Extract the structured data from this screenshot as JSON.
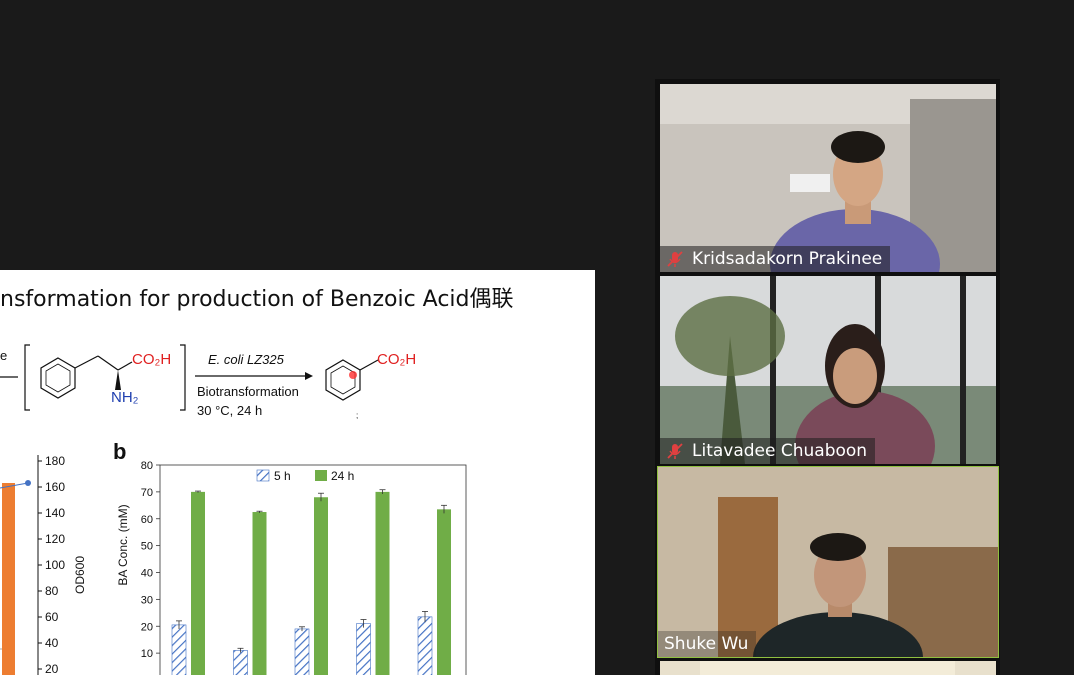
{
  "slide": {
    "title": "nsformation for production of Benzoic Acid偶联",
    "scheme": {
      "left_text": "e",
      "co2h_1": "CO₂H",
      "nh2": "NH₂",
      "enzyme": "E. coli LZ325",
      "process": "Biotransformation",
      "conditions": "30 °C, 24 h",
      "co2h_2": "CO₂H"
    },
    "left_axis": {
      "label": "OD600",
      "ticks": [
        "180",
        "160",
        "140",
        "120",
        "100",
        "80",
        "60",
        "40",
        "20"
      ]
    }
  },
  "chart_data": {
    "panel_label": "b",
    "type": "bar",
    "ylabel": "BA Conc. (mM)",
    "ylim": [
      0,
      80
    ],
    "yticks": [
      10,
      20,
      30,
      40,
      50,
      60,
      70,
      80
    ],
    "series": [
      {
        "name": "5 h",
        "values": [
          20.5,
          11,
          19,
          21,
          23.5
        ]
      },
      {
        "name": "24 h",
        "values": [
          70,
          62.5,
          68,
          70,
          63.5
        ]
      }
    ],
    "error": [
      [
        1.5,
        0.8,
        0.8,
        1.5,
        2.0
      ],
      [
        0.3,
        0.3,
        1.5,
        0.8,
        1.5
      ]
    ]
  },
  "participants": [
    {
      "name": "Kridsadakorn Prakinee",
      "muted": true
    },
    {
      "name": "Litavadee Chuaboon",
      "muted": true
    },
    {
      "name": "Shuke Wu",
      "muted": false,
      "active_speaker": true
    }
  ],
  "colors": {
    "green_bar": "#70ad47",
    "hatch_bar": "#4472c4",
    "orange_bar": "#ed7d31",
    "red": "#e02020",
    "blue_text": "#1f3fb0",
    "speaker_outline": "#90c040",
    "muted_icon": "#e04040"
  },
  "icons": [
    "muted-microphone-icon"
  ]
}
